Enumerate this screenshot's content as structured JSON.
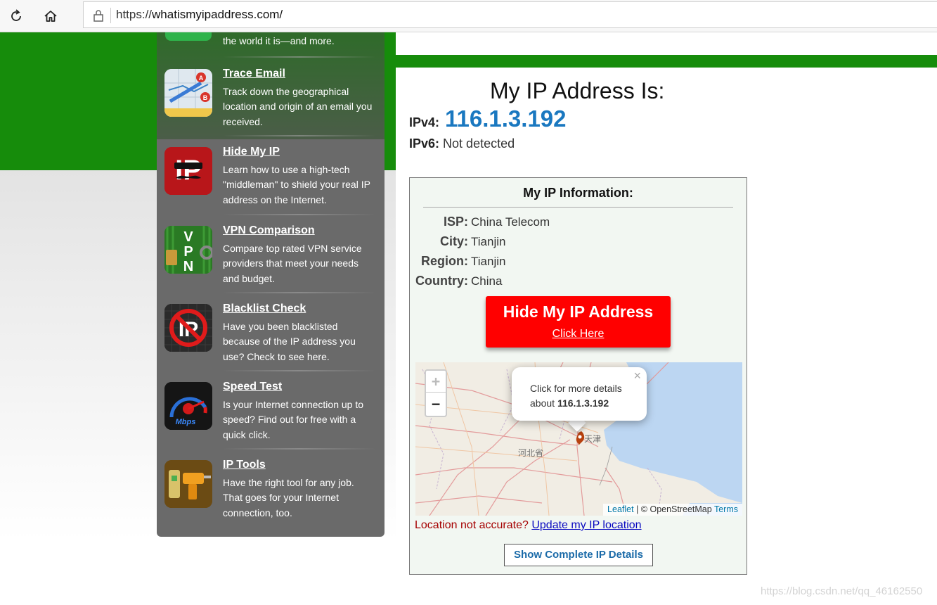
{
  "browser": {
    "url_prefix": "https://",
    "url_host": "whatismyipaddress.com/",
    "icons": [
      "refresh-icon",
      "home-icon",
      "lock-icon"
    ]
  },
  "sidebar": {
    "cutoff_text": "the world it is—and more.",
    "items": [
      {
        "title": "Trace Email",
        "desc": "Track down the geographical location and origin of an email you received.",
        "icon": "trace-email-icon"
      },
      {
        "title": "Hide My IP",
        "desc": "Learn how to use a high-tech \"middleman\" to shield your real IP address on the Internet.",
        "icon": "hide-ip-icon"
      },
      {
        "title": "VPN Comparison",
        "desc": "Compare top rated VPN service providers that meet your needs and budget.",
        "icon": "vpn-icon"
      },
      {
        "title": "Blacklist Check",
        "desc": "Have you been blacklisted because of the IP address you use? Check to see here.",
        "icon": "blacklist-icon"
      },
      {
        "title": "Speed Test",
        "desc": "Is your Internet connection up to speed? Find out for free with a quick click.",
        "icon": "speed-test-icon"
      },
      {
        "title": "IP Tools",
        "desc": "Have the right tool for any job. That goes for your Internet connection, too.",
        "icon": "ip-tools-icon"
      }
    ]
  },
  "main": {
    "heading": "My IP Address Is:",
    "ipv4_label": "IPv4:",
    "ipv4_value": "116.1.3.192",
    "ipv6_label": "IPv6:",
    "ipv6_value": "Not detected"
  },
  "info": {
    "title": "My IP Information:",
    "rows": [
      {
        "key": "ISP:",
        "value": "China Telecom"
      },
      {
        "key": "City:",
        "value": "Tianjin"
      },
      {
        "key": "Region:",
        "value": "Tianjin"
      },
      {
        "key": "Country:",
        "value": "China"
      }
    ],
    "hide_btn_title": "Hide My IP Address",
    "hide_btn_sub": "Click Here",
    "map": {
      "zoom_in": "+",
      "zoom_out": "−",
      "popup_text": "Click for more details about",
      "popup_ip": "116.1.3.192",
      "popup_close": "×",
      "attr_leaflet": "Leaflet",
      "attr_sep": "| © OpenStreetMap",
      "attr_terms": "Terms",
      "label_hebei": "河北省",
      "label_tianjin": "天津"
    },
    "location_question": "Location not accurate?",
    "location_link": "Update my IP location",
    "details_btn": "Show Complete IP Details"
  },
  "watermark": "https://blog.csdn.net/qq_46162550"
}
